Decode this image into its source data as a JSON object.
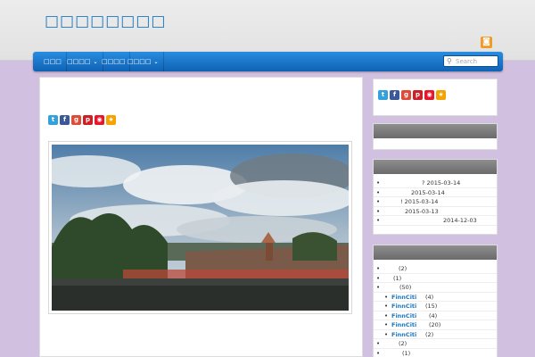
{
  "header": {
    "site_title": "□□□□□□□□",
    "rss_icon": "rss-icon"
  },
  "nav": {
    "items": [
      {
        "label": "□□□",
        "has_dropdown": false
      },
      {
        "label": "□□□□",
        "has_dropdown": true
      },
      {
        "label": "□□□□",
        "has_dropdown": false
      },
      {
        "label": "□□□□",
        "has_dropdown": true
      }
    ],
    "search_placeholder": "Search"
  },
  "share_icons": [
    {
      "name": "twitter-icon",
      "glyph": "t",
      "color": "#33a1dc"
    },
    {
      "name": "facebook-icon",
      "glyph": "f",
      "color": "#3b5998"
    },
    {
      "name": "google-plus-icon",
      "glyph": "g+",
      "color": "#dd4b39"
    },
    {
      "name": "pinterest-icon",
      "glyph": "p",
      "color": "#cb2027"
    },
    {
      "name": "weibo-icon",
      "glyph": "◉",
      "color": "#e6162d"
    },
    {
      "name": "star-icon",
      "glyph": "★",
      "color": "#f4a300"
    }
  ],
  "sidebar": {
    "recent_posts": [
      {
        "text": "? 2015-03-14"
      },
      {
        "text": "2015-03-14"
      },
      {
        "text": "! 2015-03-14"
      },
      {
        "text": "2015-03-13"
      },
      {
        "text": "2014-12-03"
      }
    ],
    "categories": [
      {
        "name": "",
        "count": "(2)"
      },
      {
        "name": "",
        "count": "(1)"
      },
      {
        "name": "",
        "count": "(50)"
      },
      {
        "name": "FinnCiti",
        "count": "(4)",
        "sub": true
      },
      {
        "name": "FinnCiti",
        "count": "(15)",
        "sub": true
      },
      {
        "name": "FinnCiti",
        "count": "(4)",
        "sub": true
      },
      {
        "name": "FinnCiti",
        "count": "(20)",
        "sub": true
      },
      {
        "name": "FinnCiti",
        "count": "(2)",
        "sub": true
      },
      {
        "name": "",
        "count": "(2)"
      },
      {
        "name": "",
        "count": "(1)"
      }
    ]
  },
  "colors": {
    "accent": "#1a78c2",
    "nav_blue": "#1670c4",
    "page_bg": "#d2c0e0"
  }
}
